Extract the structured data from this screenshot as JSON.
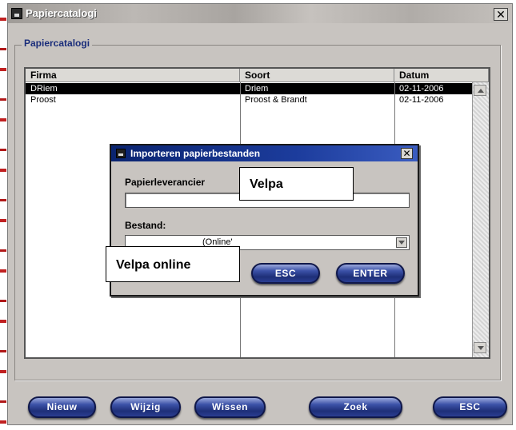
{
  "window": {
    "title": "Papiercatalogi",
    "close_glyph": "✕"
  },
  "group": {
    "label": "Papiercatalogi"
  },
  "table": {
    "columns": [
      "Firma",
      "Soort",
      "Datum"
    ],
    "rows": [
      {
        "firma": "DRiem",
        "soort": "Driem",
        "datum": "02-11-2006",
        "selected": true
      },
      {
        "firma": "Proost",
        "soort": "Proost & Brandt",
        "datum": "02-11-2006",
        "selected": false
      }
    ]
  },
  "dialog": {
    "title": "Importeren papierbestanden",
    "close_glyph": "✕",
    "supplier_label": "Papierleverancier",
    "supplier_value": "",
    "file_label": "Bestand:",
    "file_value": "(Online'",
    "esc_label": "ESC",
    "enter_label": "ENTER"
  },
  "buttons": {
    "new": "Nieuw",
    "edit": "Wijzig",
    "delete": "Wissen",
    "search": "Zoek",
    "esc": "ESC"
  },
  "callouts": {
    "supplier": "Velpa",
    "file": "Velpa online"
  },
  "colors": {
    "window_bg": "#c8c4c0",
    "dialog_title_bg": "#0a2470",
    "button_blue": "#1e2f78",
    "selection": "#000000"
  },
  "icons": [
    "app-icon",
    "close-icon",
    "dropdown-arrow-icon",
    "scroll-up-icon",
    "scroll-down-icon"
  ]
}
